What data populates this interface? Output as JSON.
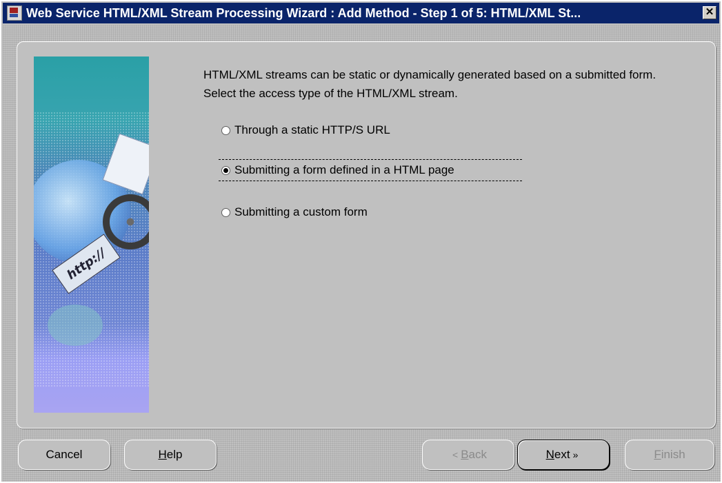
{
  "window": {
    "title": "Web Service HTML/XML Stream Processing Wizard : Add Method - Step 1 of 5: HTML/XML St...",
    "close_label": "✕"
  },
  "banner": {
    "tag_text": "http://"
  },
  "content": {
    "intro": "HTML/XML streams can be static or dynamically generated based on a submitted form. Select the access type of the HTML/XML stream.",
    "options": [
      {
        "label": "Through a static HTTP/S URL",
        "selected": false
      },
      {
        "label": "Submitting a form defined in a HTML page",
        "selected": true
      },
      {
        "label": "Submitting a custom form",
        "selected": false
      }
    ]
  },
  "buttons": {
    "cancel": "Cancel",
    "help_mnemonic": "H",
    "help_rest": "elp",
    "back_mnemonic": "B",
    "back_rest": "ack",
    "next_mnemonic": "N",
    "next_rest": "ext",
    "finish_mnemonic": "F",
    "finish_rest": "inish",
    "back_arrow": "<",
    "next_arrow": "»"
  }
}
